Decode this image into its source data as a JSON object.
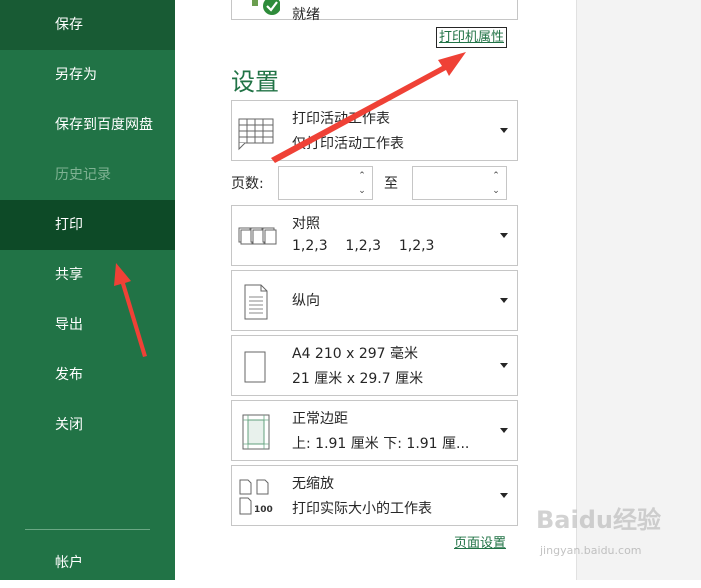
{
  "nav": {
    "items": [
      {
        "label": "保存",
        "state": "normal"
      },
      {
        "label": "另存为",
        "state": "normal"
      },
      {
        "label": "保存到百度网盘",
        "state": "normal"
      },
      {
        "label": "历史记录",
        "state": "disabled"
      },
      {
        "label": "打印",
        "state": "active"
      },
      {
        "label": "共享",
        "state": "normal"
      },
      {
        "label": "导出",
        "state": "normal"
      },
      {
        "label": "发布",
        "state": "normal"
      },
      {
        "label": "关闭",
        "state": "normal"
      }
    ],
    "account": "帐户"
  },
  "printer": {
    "status": "就绪",
    "properties_link": "打印机属性"
  },
  "settings": {
    "title": "设置",
    "what_to_print": {
      "line1": "打印活动工作表",
      "line2": "仅打印活动工作表"
    },
    "pages": {
      "label": "页数:",
      "to": "至",
      "from_value": "",
      "to_value": ""
    },
    "collation": {
      "line1": "对照",
      "line2": "1,2,3    1,2,3    1,2,3"
    },
    "orientation": {
      "label": "纵向"
    },
    "paper_size": {
      "line1": "A4 210 x 297 毫米",
      "line2": "21 厘米 x 29.7 厘米"
    },
    "margins": {
      "line1": "正常边距",
      "line2": "上: 1.91 厘米 下: 1.91 厘..."
    },
    "scaling": {
      "line1": "无缩放",
      "line2": "打印实际大小的工作表",
      "icon_number": "100"
    },
    "page_setup_link": "页面设置"
  },
  "colors": {
    "nav_bg": "#217346",
    "nav_active": "#0d4a27",
    "accent": "#217346",
    "annotation_arrow": "#ef4136"
  },
  "watermark": {
    "text": "Baidu经验",
    "url": "jingyan.baidu.com"
  }
}
